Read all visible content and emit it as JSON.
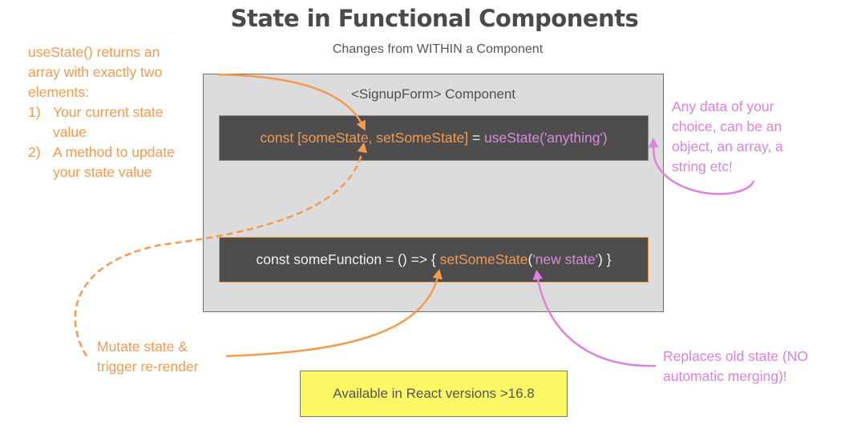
{
  "title": "State in Functional Components",
  "subtitle": "Changes from WITHIN a Component",
  "colors": {
    "orange": "#f59a4e",
    "pink": "#dd82dd",
    "code_bg": "#4d4d4d",
    "component_bg": "#dcdcdc",
    "badge_bg": "#fcf764"
  },
  "left_note": {
    "intro": [
      "useState() returns an",
      "array with exactly two",
      "elements:"
    ],
    "items": [
      {
        "num": "1)",
        "lines": [
          "Your current state",
          "value"
        ]
      },
      {
        "num": "2)",
        "lines": [
          "A method to update",
          "your state value"
        ]
      }
    ]
  },
  "component": {
    "label": "<SignupForm> Component",
    "code_line_1": {
      "destructure": "const [someState, setSomeState]",
      "equals": " = ",
      "hook": "useState('anything')"
    },
    "code_line_2": {
      "prefix": "const someFunction = () => { ",
      "setter": "setSomeState",
      "open_paren": "(",
      "arg": "'new state'",
      "suffix": ") }"
    }
  },
  "right_note": [
    "Any data of your",
    "choice, can be an",
    "object, an array, a",
    "string etc!"
  ],
  "bottom_left_note": [
    "Mutate state &",
    "trigger re-render"
  ],
  "bottom_right_note": [
    "Replaces old state (NO",
    "automatic merging)!"
  ],
  "badge": "Available in React versions >16.8"
}
